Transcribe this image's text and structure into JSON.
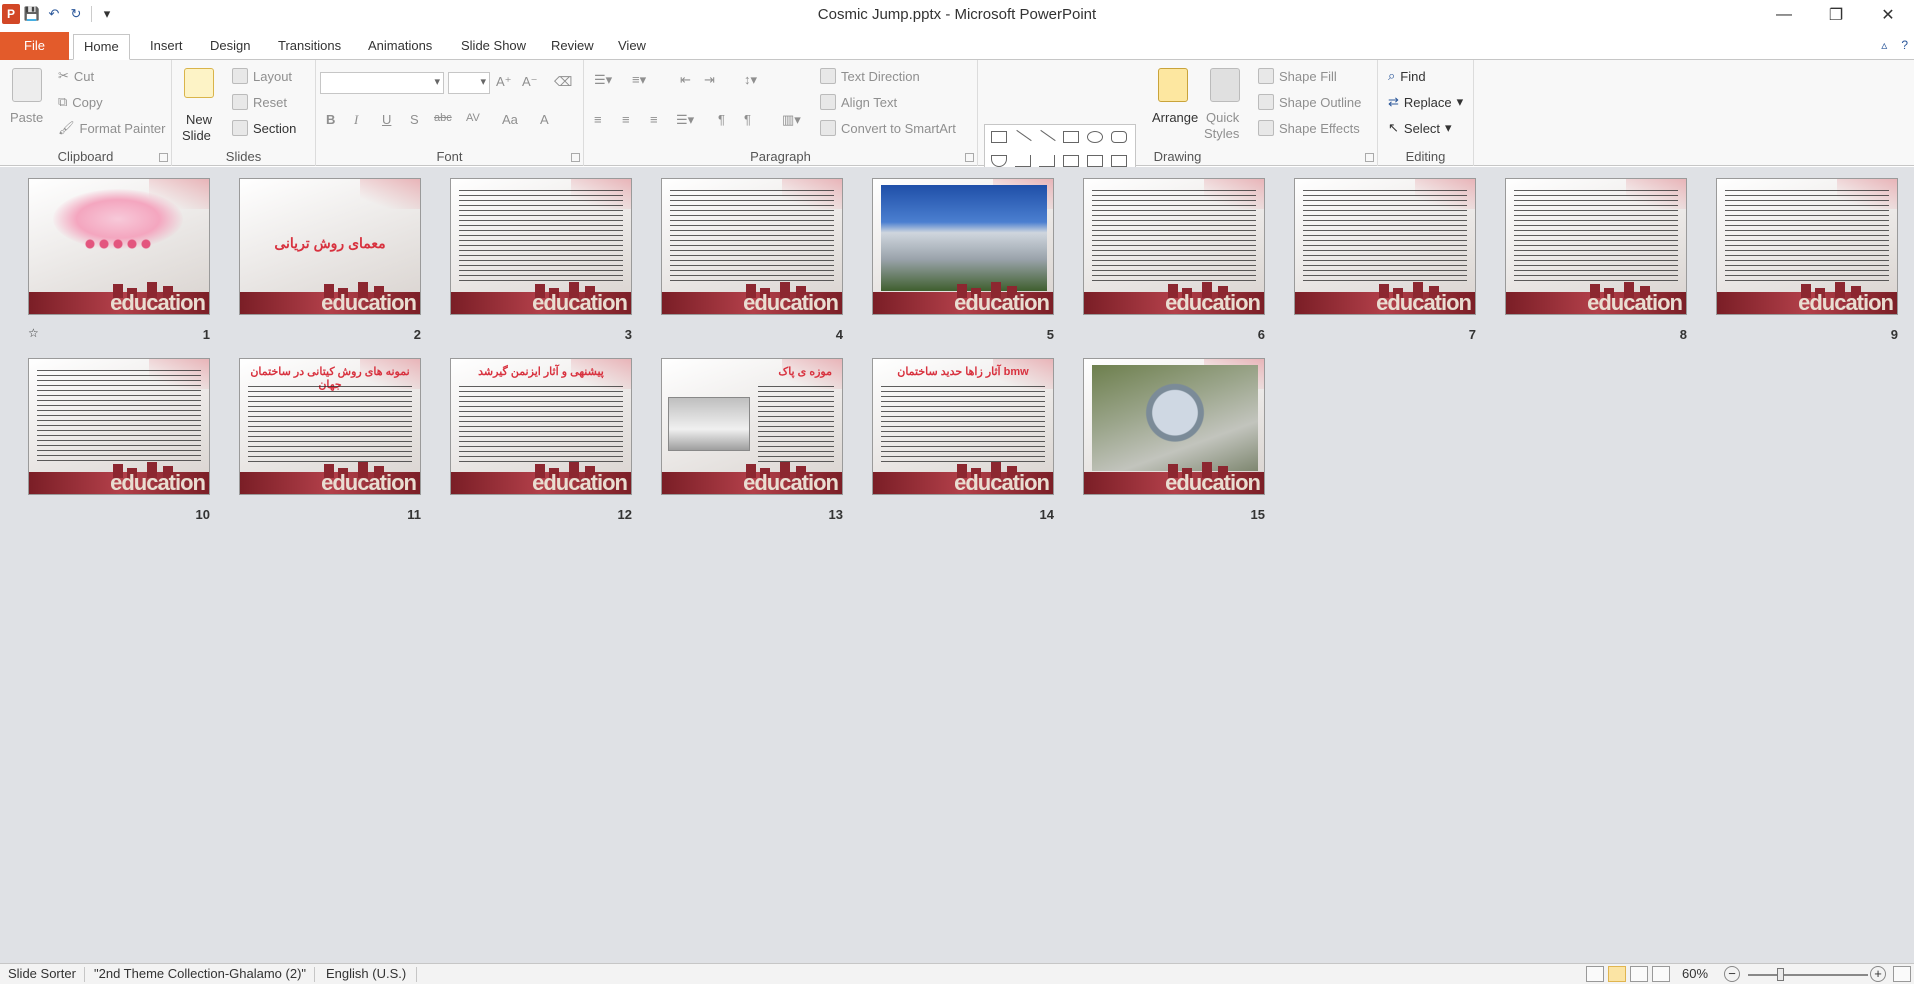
{
  "window": {
    "title": "Cosmic Jump.pptx - Microsoft PowerPoint",
    "app_logo": "P",
    "controls": {
      "minimize": "—",
      "restore": "❐",
      "close": "✕"
    }
  },
  "qat": {
    "save_icon": "💾",
    "undo_icon": "↶",
    "redo_icon": "↻",
    "customize_icon": "▾"
  },
  "tabs": {
    "file": "File",
    "items": [
      "Home",
      "Insert",
      "Design",
      "Transitions",
      "Animations",
      "Slide Show",
      "Review",
      "View"
    ],
    "active": "Home",
    "minimize_ribbon_icon": "▵",
    "help_icon": "?"
  },
  "ribbon": {
    "clipboard": {
      "label": "Clipboard",
      "paste": "Paste",
      "cut": "Cut",
      "copy": "Copy",
      "format_painter": "Format Painter"
    },
    "slides": {
      "label": "Slides",
      "new_slide_1": "New",
      "new_slide_2": "Slide",
      "layout": "Layout",
      "reset": "Reset",
      "section": "Section"
    },
    "font": {
      "label": "Font",
      "bold": "B",
      "italic": "I",
      "underline": "U",
      "shadow": "S",
      "strike": "abc",
      "spacing": "AV",
      "case": "Aa",
      "color": "A",
      "grow": "A⁺",
      "shrink": "A⁻"
    },
    "paragraph": {
      "label": "Paragraph",
      "text_direction": "Text Direction",
      "align_text": "Align Text",
      "convert_smartart": "Convert to SmartArt"
    },
    "drawing": {
      "label": "Drawing",
      "arrange": "Arrange",
      "quick_styles_1": "Quick",
      "quick_styles_2": "Styles",
      "shape_fill": "Shape Fill",
      "shape_outline": "Shape Outline",
      "shape_effects": "Shape Effects"
    },
    "editing": {
      "label": "Editing",
      "find": "Find",
      "replace": "Replace",
      "select": "Select"
    }
  },
  "slides": [
    {
      "num": "1",
      "kind": "calligraphy"
    },
    {
      "num": "2",
      "kind": "title",
      "heading": "معمای روش تریانی"
    },
    {
      "num": "3",
      "kind": "text"
    },
    {
      "num": "4",
      "kind": "text"
    },
    {
      "num": "5",
      "kind": "photo-building"
    },
    {
      "num": "6",
      "kind": "text"
    },
    {
      "num": "7",
      "kind": "text"
    },
    {
      "num": "8",
      "kind": "text"
    },
    {
      "num": "9",
      "kind": "text"
    },
    {
      "num": "10",
      "kind": "text"
    },
    {
      "num": "11",
      "kind": "heading-text",
      "heading": "نمونه های روش کیتانی در ساختمان جهان"
    },
    {
      "num": "12",
      "kind": "heading-text",
      "heading": "پیشنهی و آثار ایزنمن گیرشد"
    },
    {
      "num": "13",
      "kind": "text-smallphoto",
      "heading": "موزه ی پاک"
    },
    {
      "num": "14",
      "kind": "heading-text",
      "heading": "آثار زاها حدید ساختمان bmw"
    },
    {
      "num": "15",
      "kind": "photo-tower"
    }
  ],
  "slide_footer_text": "education",
  "status": {
    "view": "Slide Sorter",
    "theme": "\"2nd Theme Collection-Ghalamo (2)\"",
    "language": "English (U.S.)",
    "zoom": "60%",
    "zoom_value": 60
  },
  "colors": {
    "file_tab": "#e35b2b",
    "sorter_bg": "#dfe1e5",
    "accent_red": "#d8323f",
    "band": "#7a1e26"
  }
}
